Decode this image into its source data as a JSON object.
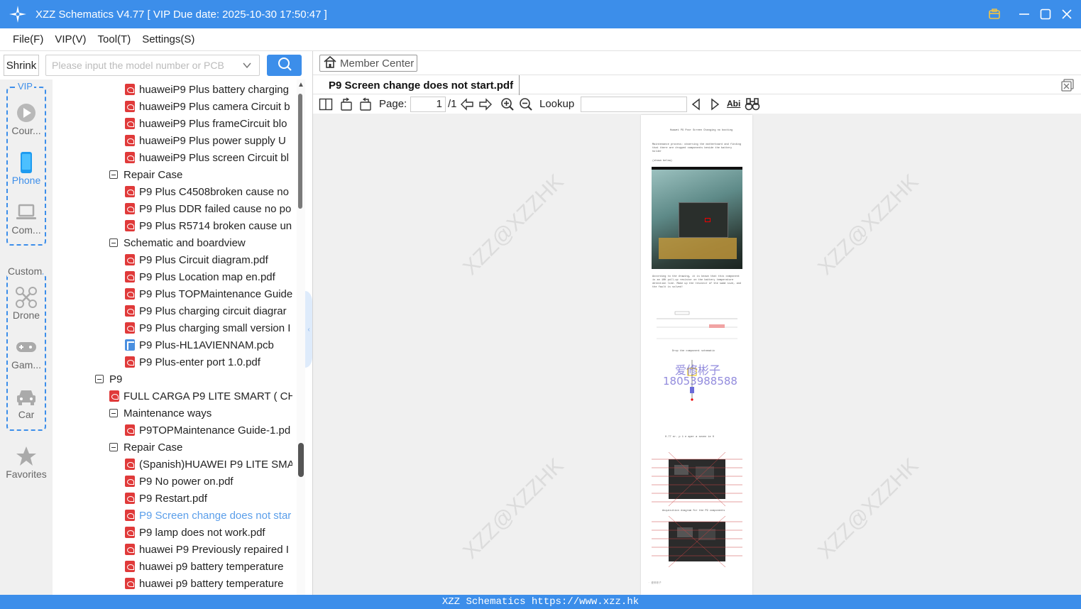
{
  "window": {
    "title": "XZZ Schematics V4.77 [ VIP Due date: 2025-10-30 17:50:47 ]"
  },
  "menu": [
    "File(F)",
    "VIP(V)",
    "Tool(T)",
    "Settings(S)"
  ],
  "search": {
    "shrink_label": "Shrink",
    "placeholder": "Please input the model number or PCB"
  },
  "rail": {
    "vip_label": "VIP",
    "custom_label": "Custom",
    "items": [
      {
        "label": "Cour...",
        "icon": "play-circle-icon",
        "active": false
      },
      {
        "label": "Phone",
        "icon": "phone-icon",
        "active": true
      },
      {
        "label": "Com...",
        "icon": "laptop-icon",
        "active": false
      },
      {
        "label": "Drone",
        "icon": "drone-icon",
        "active": false
      },
      {
        "label": "Gam...",
        "icon": "gamepad-icon",
        "active": false
      },
      {
        "label": "Car",
        "icon": "car-icon",
        "active": false
      },
      {
        "label": "Favorites",
        "icon": "star-icon",
        "active": false
      }
    ]
  },
  "tree": [
    {
      "label": "huaweiP9 Plus battery charging",
      "type": "pdf",
      "level": 2
    },
    {
      "label": "huaweiP9 Plus camera Circuit b",
      "type": "pdf",
      "level": 2
    },
    {
      "label": "huaweiP9 Plus frameCircuit blo",
      "type": "pdf",
      "level": 2
    },
    {
      "label": "huaweiP9 Plus power supply U",
      "type": "pdf",
      "level": 2
    },
    {
      "label": "huaweiP9 Plus screen Circuit bl",
      "type": "pdf",
      "level": 2
    },
    {
      "label": "Repair Case",
      "type": "folder",
      "level": 1
    },
    {
      "label": "P9 Plus C4508broken cause no",
      "type": "pdf",
      "level": 2
    },
    {
      "label": "P9 Plus DDR failed cause no po",
      "type": "pdf",
      "level": 2
    },
    {
      "label": "P9 Plus R5714 broken cause un",
      "type": "pdf",
      "level": 2
    },
    {
      "label": "Schematic and boardview",
      "type": "folder",
      "level": 1
    },
    {
      "label": "P9 Plus Circuit diagram.pdf",
      "type": "pdf",
      "level": 2
    },
    {
      "label": "P9 Plus Location map en.pdf",
      "type": "pdf",
      "level": 2
    },
    {
      "label": "P9 Plus TOPMaintenance Guide",
      "type": "pdf",
      "level": 2
    },
    {
      "label": "P9 Plus charging circuit diagrar",
      "type": "pdf",
      "level": 2
    },
    {
      "label": "P9 Plus charging small version I",
      "type": "pdf",
      "level": 2
    },
    {
      "label": "P9 Plus-HL1AVIENNAM.pcb",
      "type": "pcb",
      "level": 2
    },
    {
      "label": "P9 Plus-enter port 1.0.pdf",
      "type": "pdf",
      "level": 2
    },
    {
      "label": "P9",
      "type": "folder",
      "level": 0
    },
    {
      "label": "FULL CARGA P9 LITE SMART ( CHA",
      "type": "pdf",
      "level": 1
    },
    {
      "label": "Maintenance ways",
      "type": "folder",
      "level": 1
    },
    {
      "label": "P9TOPMaintenance Guide-1.pd",
      "type": "pdf",
      "level": 2
    },
    {
      "label": "Repair Case",
      "type": "folder",
      "level": 1
    },
    {
      "label": "(Spanish)HUAWEI P9 LITE SMAI",
      "type": "pdf",
      "level": 2
    },
    {
      "label": "P9 No power on.pdf",
      "type": "pdf",
      "level": 2
    },
    {
      "label": "P9 Restart.pdf",
      "type": "pdf",
      "level": 2
    },
    {
      "label": "P9 Screen change does not star",
      "type": "pdf",
      "level": 2,
      "selected": true
    },
    {
      "label": "P9 lamp does not work.pdf",
      "type": "pdf",
      "level": 2
    },
    {
      "label": "huawei P9 Previously repaired I",
      "type": "pdf",
      "level": 2
    },
    {
      "label": "huawei p9 battery temperature",
      "type": "pdf",
      "level": 2
    },
    {
      "label": "huawei p9 battery temperature",
      "type": "pdf",
      "level": 2
    }
  ],
  "right": {
    "member_center": "Member Center",
    "tab_title": "P9 Screen change does not start.pdf",
    "toolbar": {
      "page_label": "Page:",
      "page_value": "1",
      "page_total": "/1",
      "lookup_label": "Lookup",
      "abi_label": "Abi"
    },
    "watermark": "XZZ@XZZHK",
    "pdf": {
      "title": "Huawei P9 Poor Screen Changing no booting",
      "intro": "Maintenance process: observing the motherboard and finding that there are dropped components beside the battery holder",
      "shown": "(shown below)",
      "para2": "According to the drawing, it is known that this component is an 10K pull-up resistor on the battery temperature detection line. Make up the resistor of the same size, and the fault is solved!",
      "caption1": "Drop the component schematic",
      "overlay_cn": "爱修彬子",
      "overlay_phone": "18053988588",
      "caption2": "0.77 er.    p    1 e aper a seven ie    0",
      "caption3": "Acquisition diagram for the P9 components",
      "footer": "· 爱修彬子       "
    }
  },
  "statusbar": "XZZ Schematics https://www.xzz.hk"
}
